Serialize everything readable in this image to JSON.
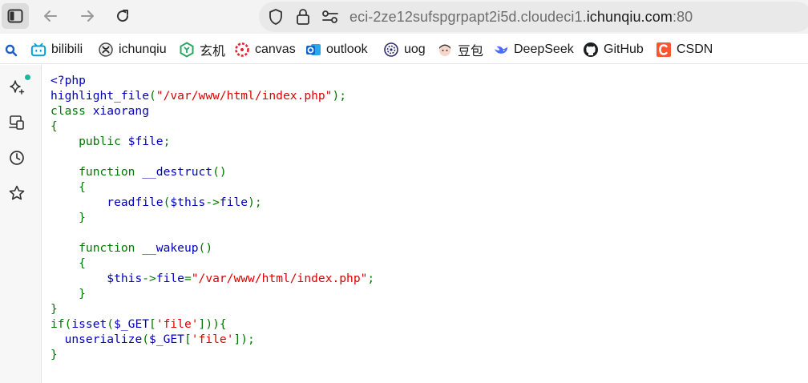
{
  "toolbar": {
    "url": {
      "prefix": "eci-2ze12sufspgrpapt2i5d.cloudeci1.",
      "domain": "ichunqiu.com",
      "port": ":80"
    }
  },
  "bookmarks": [
    {
      "label": "bilibili",
      "icon": "bilibili-icon",
      "color": "#00a1d6"
    },
    {
      "label": "ichunqiu",
      "icon": "ichunqiu-icon",
      "color": "#333333"
    },
    {
      "label": "玄机",
      "icon": "xuanji-icon",
      "color": "#2aa663"
    },
    {
      "label": "canvas",
      "icon": "canvas-icon",
      "color": "#e72429"
    },
    {
      "label": "outlook",
      "icon": "outlook-icon",
      "color": "#0a64d6"
    },
    {
      "label": "uog",
      "icon": "uog-icon",
      "color": "#2b2d6e"
    },
    {
      "label": "豆包",
      "icon": "doubao-icon",
      "color": "#f2b9a8"
    },
    {
      "label": "DeepSeek",
      "icon": "deepseek-icon",
      "color": "#4d6bfe"
    },
    {
      "label": "GitHub",
      "icon": "github-icon",
      "color": "#1b1f23"
    },
    {
      "label": "CSDN",
      "icon": "csdn-icon",
      "color": "#fc5531"
    }
  ],
  "code": {
    "colors": {
      "default": "#0000bb",
      "keyword": "#007700",
      "string": "#dd0000"
    },
    "lines": [
      [
        {
          "t": "<?php",
          "c": "def"
        }
      ],
      [
        {
          "t": "highlight_file",
          "c": "def"
        },
        {
          "t": "(",
          "c": "kw"
        },
        {
          "t": "\"/var/www/html/index.php\"",
          "c": "str"
        },
        {
          "t": ");",
          "c": "kw"
        }
      ],
      [
        {
          "t": "class ",
          "c": "kw"
        },
        {
          "t": "xiaorang",
          "c": "def"
        }
      ],
      [
        {
          "t": "{",
          "c": "kw"
        }
      ],
      [
        {
          "t": "    public ",
          "c": "kw"
        },
        {
          "t": "$file",
          "c": "def"
        },
        {
          "t": ";",
          "c": "kw"
        }
      ],
      [
        {
          "t": "",
          "c": "def"
        }
      ],
      [
        {
          "t": "    function ",
          "c": "kw"
        },
        {
          "t": "__destruct",
          "c": "def"
        },
        {
          "t": "()",
          "c": "kw"
        }
      ],
      [
        {
          "t": "    {",
          "c": "kw"
        }
      ],
      [
        {
          "t": "        ",
          "c": "def"
        },
        {
          "t": "readfile",
          "c": "def"
        },
        {
          "t": "(",
          "c": "kw"
        },
        {
          "t": "$this",
          "c": "def"
        },
        {
          "t": "->",
          "c": "kw"
        },
        {
          "t": "file",
          "c": "def"
        },
        {
          "t": ");",
          "c": "kw"
        }
      ],
      [
        {
          "t": "    }",
          "c": "kw"
        }
      ],
      [
        {
          "t": "",
          "c": "def"
        }
      ],
      [
        {
          "t": "    function ",
          "c": "kw"
        },
        {
          "t": "__wakeup",
          "c": "def"
        },
        {
          "t": "()",
          "c": "kw"
        }
      ],
      [
        {
          "t": "    {",
          "c": "kw"
        }
      ],
      [
        {
          "t": "        ",
          "c": "def"
        },
        {
          "t": "$this",
          "c": "def"
        },
        {
          "t": "->",
          "c": "kw"
        },
        {
          "t": "file",
          "c": "def"
        },
        {
          "t": "=",
          "c": "kw"
        },
        {
          "t": "\"/var/www/html/index.php\"",
          "c": "str"
        },
        {
          "t": ";",
          "c": "kw"
        }
      ],
      [
        {
          "t": "    }",
          "c": "kw"
        }
      ],
      [
        {
          "t": "}",
          "c": "kw"
        }
      ],
      [
        {
          "t": "if(",
          "c": "kw"
        },
        {
          "t": "isset",
          "c": "def"
        },
        {
          "t": "(",
          "c": "kw"
        },
        {
          "t": "$_GET",
          "c": "def"
        },
        {
          "t": "[",
          "c": "kw"
        },
        {
          "t": "'file'",
          "c": "str"
        },
        {
          "t": "])){",
          "c": "kw"
        }
      ],
      [
        {
          "t": "  ",
          "c": "def"
        },
        {
          "t": "unserialize",
          "c": "def"
        },
        {
          "t": "(",
          "c": "kw"
        },
        {
          "t": "$_GET",
          "c": "def"
        },
        {
          "t": "[",
          "c": "kw"
        },
        {
          "t": "'file'",
          "c": "str"
        },
        {
          "t": "]);",
          "c": "kw"
        }
      ],
      [
        {
          "t": "}",
          "c": "kw"
        }
      ]
    ]
  }
}
